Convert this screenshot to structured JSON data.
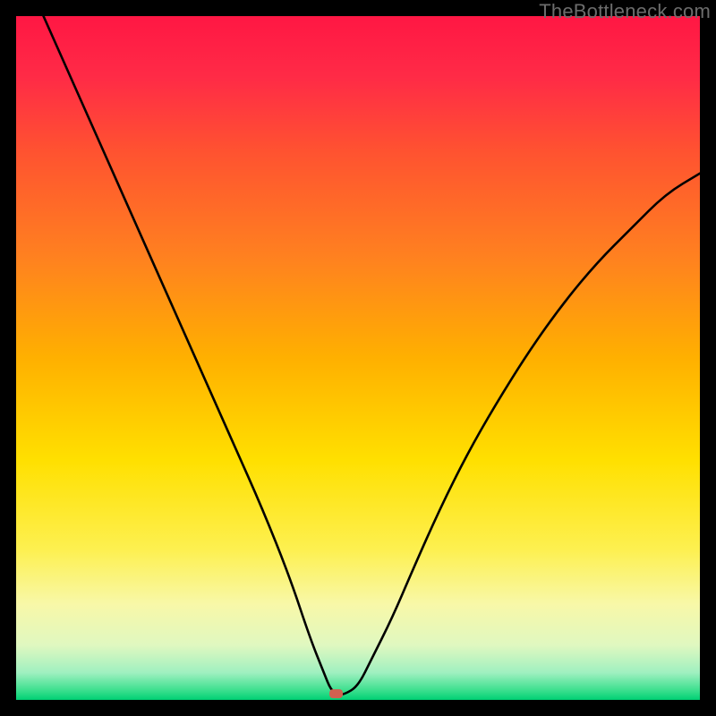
{
  "watermark": "TheBottleneck.com",
  "chart_data": {
    "type": "line",
    "title": "",
    "xlabel": "",
    "ylabel": "",
    "xlim": [
      0,
      100
    ],
    "ylim": [
      0,
      100
    ],
    "background_gradient_stops": [
      {
        "offset": 0.0,
        "color": "#ff1744"
      },
      {
        "offset": 0.09,
        "color": "#ff2b46"
      },
      {
        "offset": 0.2,
        "color": "#ff5330"
      },
      {
        "offset": 0.35,
        "color": "#ff8020"
      },
      {
        "offset": 0.5,
        "color": "#ffb000"
      },
      {
        "offset": 0.65,
        "color": "#ffe000"
      },
      {
        "offset": 0.78,
        "color": "#fdf050"
      },
      {
        "offset": 0.86,
        "color": "#f8f8a8"
      },
      {
        "offset": 0.92,
        "color": "#e0f8c0"
      },
      {
        "offset": 0.96,
        "color": "#a0f0c0"
      },
      {
        "offset": 0.985,
        "color": "#40e090"
      },
      {
        "offset": 1.0,
        "color": "#00d074"
      }
    ],
    "series": [
      {
        "name": "bottleneck-curve",
        "x": [
          4,
          8,
          12,
          16,
          20,
          24,
          28,
          32,
          36,
          40,
          43,
          45,
          46,
          47,
          48,
          50,
          52,
          55,
          58,
          62,
          66,
          70,
          75,
          80,
          85,
          90,
          95,
          100
        ],
        "y": [
          100,
          91,
          82,
          73,
          64,
          55,
          46,
          37,
          28,
          18,
          9,
          4,
          1.5,
          0.8,
          0.8,
          2,
          6,
          12,
          19,
          28,
          36,
          43,
          51,
          58,
          64,
          69,
          74,
          77
        ]
      }
    ],
    "marker": {
      "x": 46.8,
      "y": 0.9,
      "color": "#d06050"
    }
  }
}
